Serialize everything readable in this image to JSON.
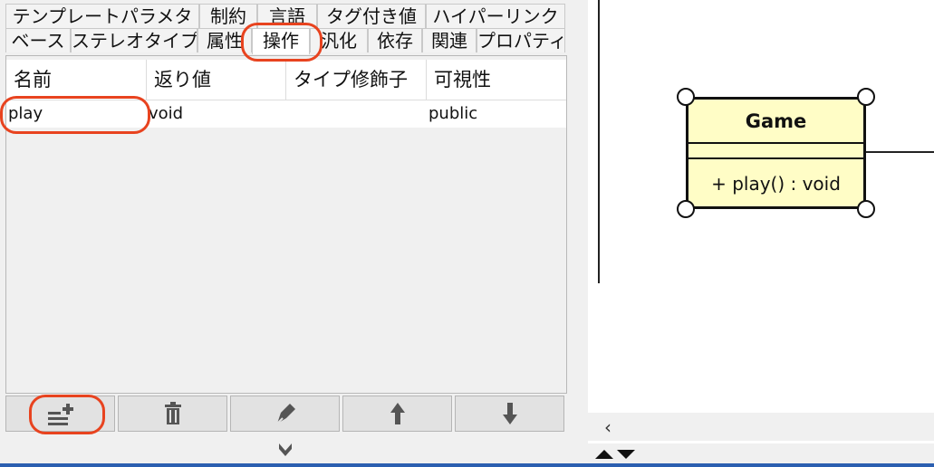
{
  "tabs_row1": [
    "テンプレートパラメタ",
    "制約",
    "言語",
    "タグ付き値",
    "ハイパーリンク"
  ],
  "tabs_row2": [
    "ベース",
    "ステレオタイプ",
    "属性",
    "操作",
    "汎化",
    "依存",
    "関連",
    "プロパティ"
  ],
  "selected_tab": "操作",
  "table": {
    "columns": [
      "名前",
      "返り値",
      "タイプ修飾子",
      "可視性"
    ],
    "rows": [
      {
        "name": "play",
        "return": "void",
        "type_modifier": "",
        "visibility": "public"
      }
    ]
  },
  "toolbar": {
    "icons": [
      "add-operation-icon",
      "trash-icon",
      "pen-icon",
      "arrow-up-icon",
      "arrow-down-icon"
    ]
  },
  "diagram": {
    "class_name": "Game",
    "operation": "+ play() : void"
  },
  "scrollbar": {
    "left_arrow": "‹"
  },
  "colors": {
    "highlight": "#e8431f",
    "class_fill": "#fffdc6",
    "panel_bg": "#f0f0f0",
    "accent_bar": "#2b5fb0"
  }
}
